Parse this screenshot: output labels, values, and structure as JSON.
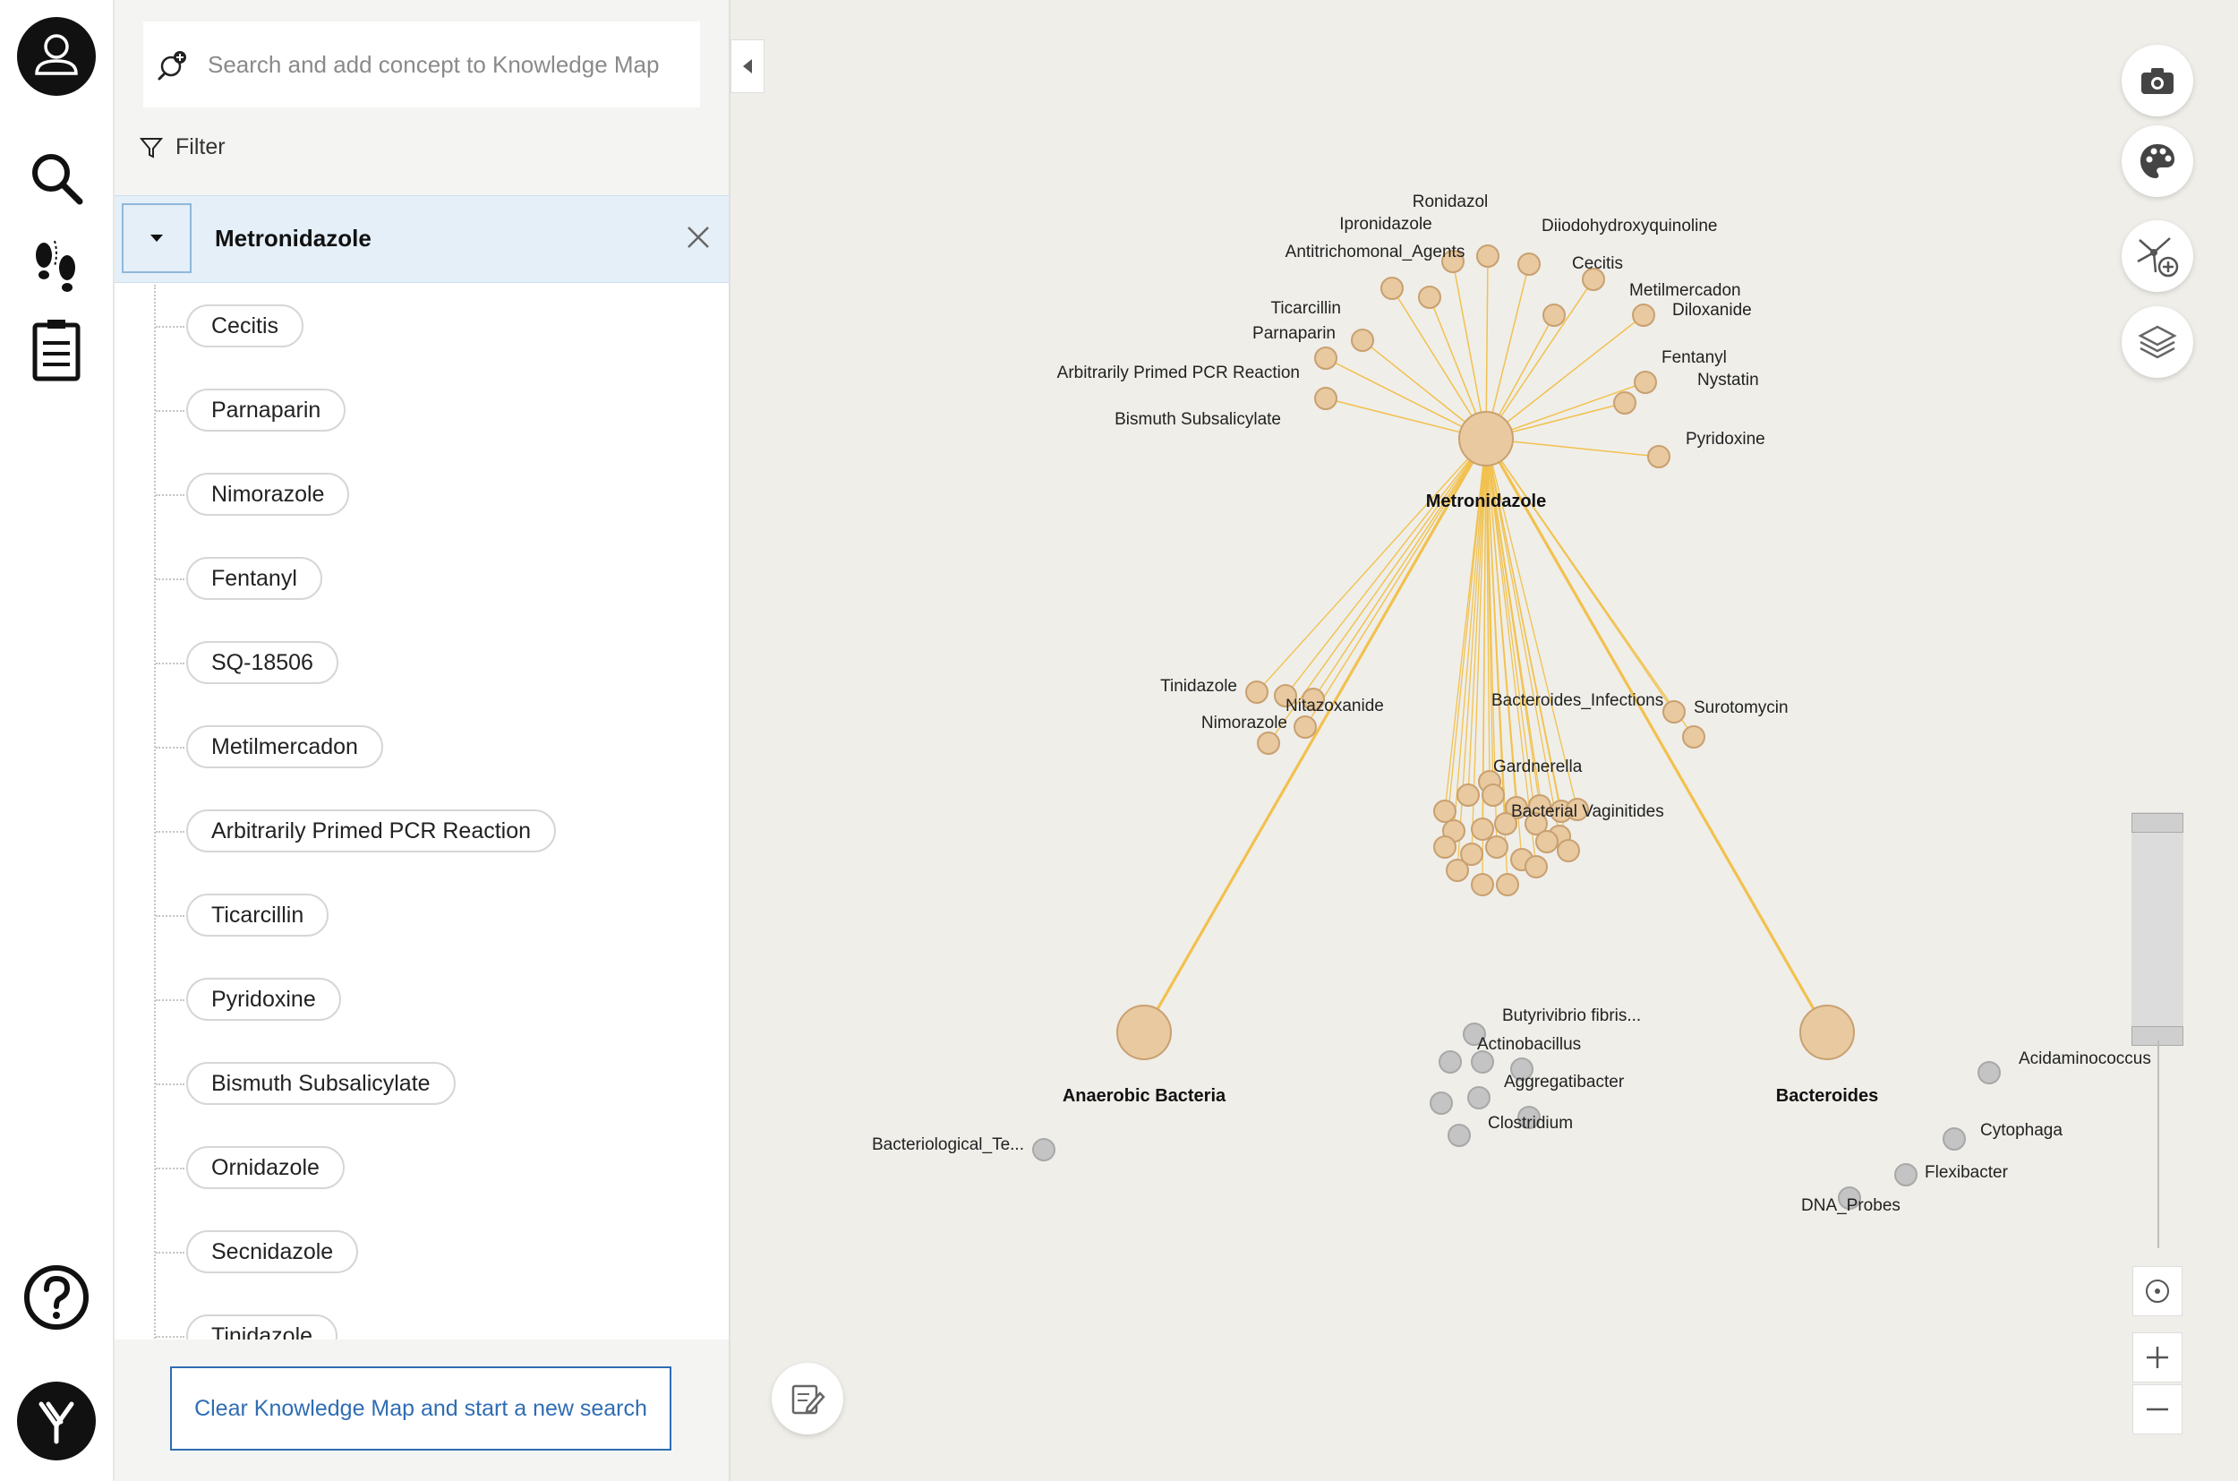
{
  "search": {
    "placeholder": "Search and add concept to Knowledge Map"
  },
  "filter": {
    "label": "Filter"
  },
  "selected": {
    "label": "Metronidazole"
  },
  "chips": [
    "Cecitis",
    "Parnaparin",
    "Nimorazole",
    "Fentanyl",
    "SQ-18506",
    "Metilmercadon",
    "Arbitrarily Primed PCR Reaction",
    "Ticarcillin",
    "Pyridoxine",
    "Bismuth Subsalicylate",
    "Ornidazole",
    "Secnidazole",
    "Tinidazole"
  ],
  "clear_button": {
    "label": "Clear Knowledge Map and start a new search"
  },
  "graph": {
    "center": {
      "label": "Metronidazole"
    },
    "hubs": [
      {
        "label": "Anaerobic Bacteria"
      },
      {
        "label": "Bacteroides"
      }
    ],
    "top_labels": [
      "Ronidazol",
      "Ipronidazole",
      "Diiodohydroxyquinoline",
      "Antitrichomonal_Agents",
      "Cecitis",
      "Metilmercadon",
      "Diloxanide",
      "Ticarcillin",
      "Parnaparin",
      "Fentanyl",
      "Nystatin",
      "Arbitrarily Primed PCR Reaction",
      "Bismuth Subsalicylate",
      "Pyridoxine"
    ],
    "mid_labels": [
      "Tinidazole",
      "Nitazoxanide",
      "Nimorazole",
      "Bacteroides_Infections",
      "Surotomycin",
      "Gardnerella",
      "Bacterial Vaginitides"
    ],
    "grey_labels": [
      "Butyrivibrio fibris...",
      "Actinobacillus",
      "Aggregatibacter",
      "Clostridium",
      "Bacteriological_Te...",
      "Acidaminococcus",
      "Cytophaga",
      "Flexibacter",
      "DNA_Probes"
    ]
  },
  "colors": {
    "edge": "#f2c14e",
    "node_fill": "#e8c9a0",
    "node_stroke": "#c9a070",
    "grey_node": "#c4c4c4",
    "accent": "#2f6db3"
  }
}
